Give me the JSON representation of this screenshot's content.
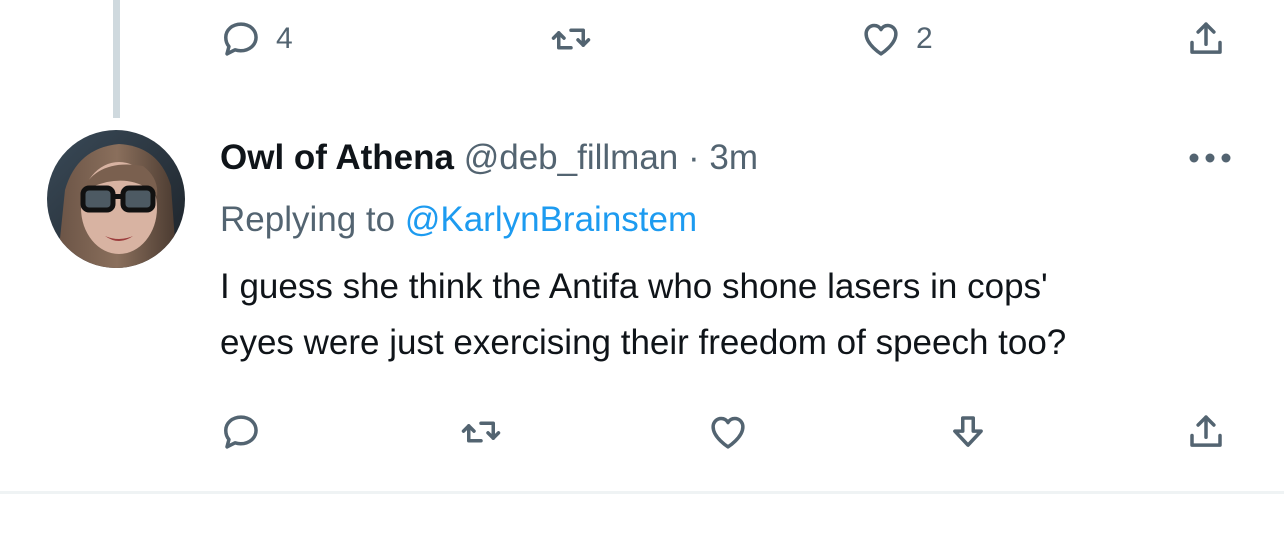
{
  "previous_tweet": {
    "actions": {
      "reply_count": "4",
      "retweet_count": "",
      "like_count": "2"
    }
  },
  "tweet": {
    "author": {
      "display_name": "Owl of Athena",
      "handle": "@deb_fillman",
      "separator": "·",
      "timestamp": "3m"
    },
    "replying": {
      "prefix": "Replying to",
      "mention": "@KarlynBrainstem"
    },
    "text_lines": [
      "I guess she think the Antifa who shone lasers in cops'",
      "eyes were just exercising their freedom of speech too?"
    ]
  },
  "icons": {
    "reply": "speech-bubble-icon",
    "retweet": "retweet-arrows-icon",
    "like": "heart-outline-icon",
    "downvote": "down-arrow-icon",
    "share": "share-upload-icon",
    "more": "three-dots-icon"
  },
  "colors": {
    "primary_text": "#0f1419",
    "secondary_text": "#536471",
    "link": "#1d9bf0",
    "thread_line": "#cfd9de",
    "divider": "#eff3f4"
  }
}
